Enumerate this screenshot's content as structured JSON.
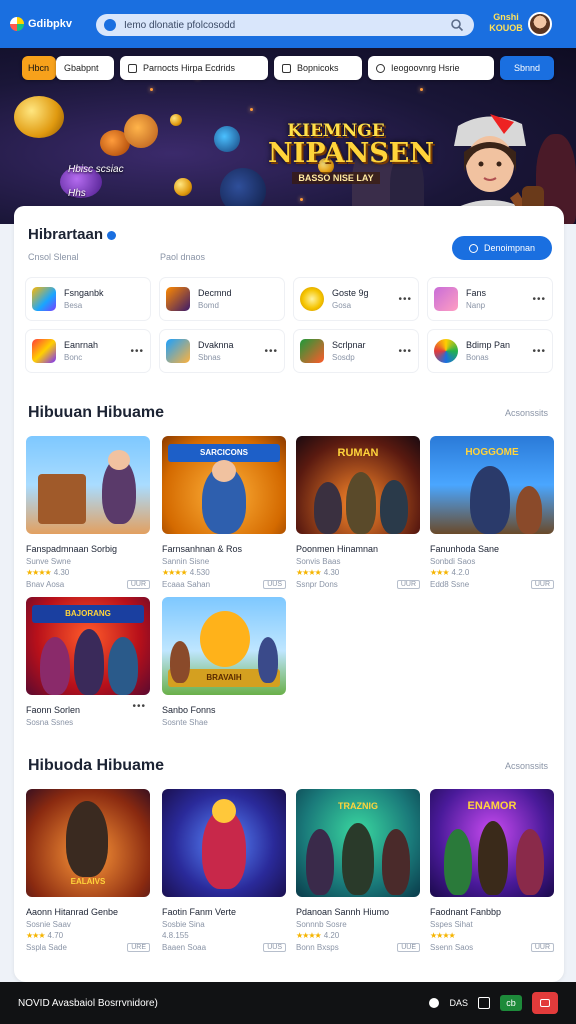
{
  "app": {
    "name": "Gdibpkv",
    "search_text": "Iemo dlonatie pfolcosodd",
    "top_label": "Gnshi KOUOB",
    "colors": {
      "primary": "#1a6fe0",
      "accent": "#f7a11b",
      "dark": "#111214"
    }
  },
  "filters": [
    {
      "label": "Hbcn",
      "style": "orange"
    },
    {
      "label": "Gbabpnt",
      "style": "plain"
    },
    {
      "label": "Parnocts Hirpa  Ecdrids",
      "style": "plain"
    },
    {
      "label": "Bopnicoks",
      "style": "plain"
    },
    {
      "label": "Ieogoovnrg     Hsrie",
      "style": "plain"
    },
    {
      "label": "Sbnnd",
      "style": "blue"
    }
  ],
  "hero": {
    "side_words": [
      "Hbisc scsiac",
      "Hhs"
    ],
    "title_line1": "KIEMNGE",
    "title_line2": "NIPANSEN",
    "title_line3": "BASSO NISE LAY"
  },
  "featured": {
    "title": "Hibrartaan",
    "sub_left": "Cnsol Slenal",
    "sub_right": "Paol dnaos",
    "button_label": "Denoimpnan",
    "apps": [
      {
        "name": "Fsnganbk",
        "sub": "Besa",
        "icon": "game-icon"
      },
      {
        "name": "Decmnd",
        "sub": "Bomd",
        "icon": "game-icon"
      },
      {
        "name": "Goste 9g",
        "sub": "Gosa",
        "icon": "coin-icon"
      },
      {
        "name": "Fans",
        "sub": "Nanp",
        "icon": "game-icon"
      },
      {
        "name": "Eanrnah",
        "sub": "Bonc",
        "icon": "game-icon"
      },
      {
        "name": "Dvaknna",
        "sub": "Sbnas",
        "icon": "game-icon"
      },
      {
        "name": "Scrlpnar",
        "sub": "Sosdp",
        "icon": "game-icon"
      },
      {
        "name": "Bdimp Pan",
        "sub": "Bonas",
        "icon": "game-icon"
      }
    ]
  },
  "section1": {
    "title": "Hibuuan Hibuame",
    "see_all": "Acsonssits",
    "cards": [
      {
        "thumb_title": "",
        "name": "Fanspadmnaan Sorbig",
        "sub": "Sunve Swne",
        "rating": "4.30",
        "stars": "★★★★",
        "foot": "Bnav Aosa",
        "tag": "UUR"
      },
      {
        "thumb_title": "SARCICONS",
        "name": "Farnsanhnan & Ros",
        "sub": "Sannin Sisne",
        "rating": "4.530",
        "stars": "★★★★",
        "foot": "Ecaaa Sahan",
        "tag": "UUS"
      },
      {
        "thumb_title": "RUMAN",
        "name": "Poonmen Hinamnan",
        "sub": "Sonvis Baas",
        "rating": "4.30",
        "stars": "★★★★",
        "foot": "Ssnpr Dons",
        "tag": "UUR"
      },
      {
        "thumb_title": "HOGGOME",
        "name": "Fanunhoda Sane",
        "sub": "Sonbdi Saos",
        "rating": "4.2.0",
        "stars": "★★★",
        "foot": "Edd8 Ssne",
        "tag": "UUR"
      },
      {
        "thumb_title": "BAJORANG",
        "name": "Faonn Sorlen",
        "sub": "Sosna Ssnes",
        "rating": "",
        "stars": "",
        "foot": "",
        "tag": ""
      },
      {
        "thumb_title": "BRAVAIH",
        "name": "Sanbo Fonns",
        "sub": "Sosnte Shae",
        "rating": "",
        "stars": "",
        "foot": "",
        "tag": ""
      }
    ]
  },
  "section2": {
    "title": "Hibuoda Hibuame",
    "see_all": "Acsonssits",
    "cards": [
      {
        "thumb_title": "EALAIVS",
        "name": "Aaonn Hitanrad Genbe",
        "sub": "Sosnie Saav",
        "rating": "4.70",
        "stars": "★★★",
        "foot": "Sspla Sade",
        "tag": "URE"
      },
      {
        "thumb_title": "",
        "name": "Faotin Fanm Verte",
        "sub": "Sosbie Sina",
        "rating": "4.8.155",
        "stars": "",
        "foot": "Baaen Soaa",
        "tag": "UUS"
      },
      {
        "thumb_title": "TRAZNIG",
        "name": "Pdanoan Sannh Hiumo",
        "sub": "Sonnnb Sosre",
        "rating": "4.20",
        "stars": "★★★★",
        "foot": "Bonn Bxsps",
        "tag": "UUE"
      },
      {
        "thumb_title": "ENAMOR",
        "name": "Faodnant Fanbbp",
        "sub": "Sspes Sihat",
        "rating": "",
        "stars": "★★★★",
        "foot": "Ssenn Saos",
        "tag": "UUR"
      }
    ]
  },
  "bottombar": {
    "text": "NOVID Avasbaiol Bosrrvnidore)",
    "label": "DAS",
    "green_label": "cb"
  }
}
